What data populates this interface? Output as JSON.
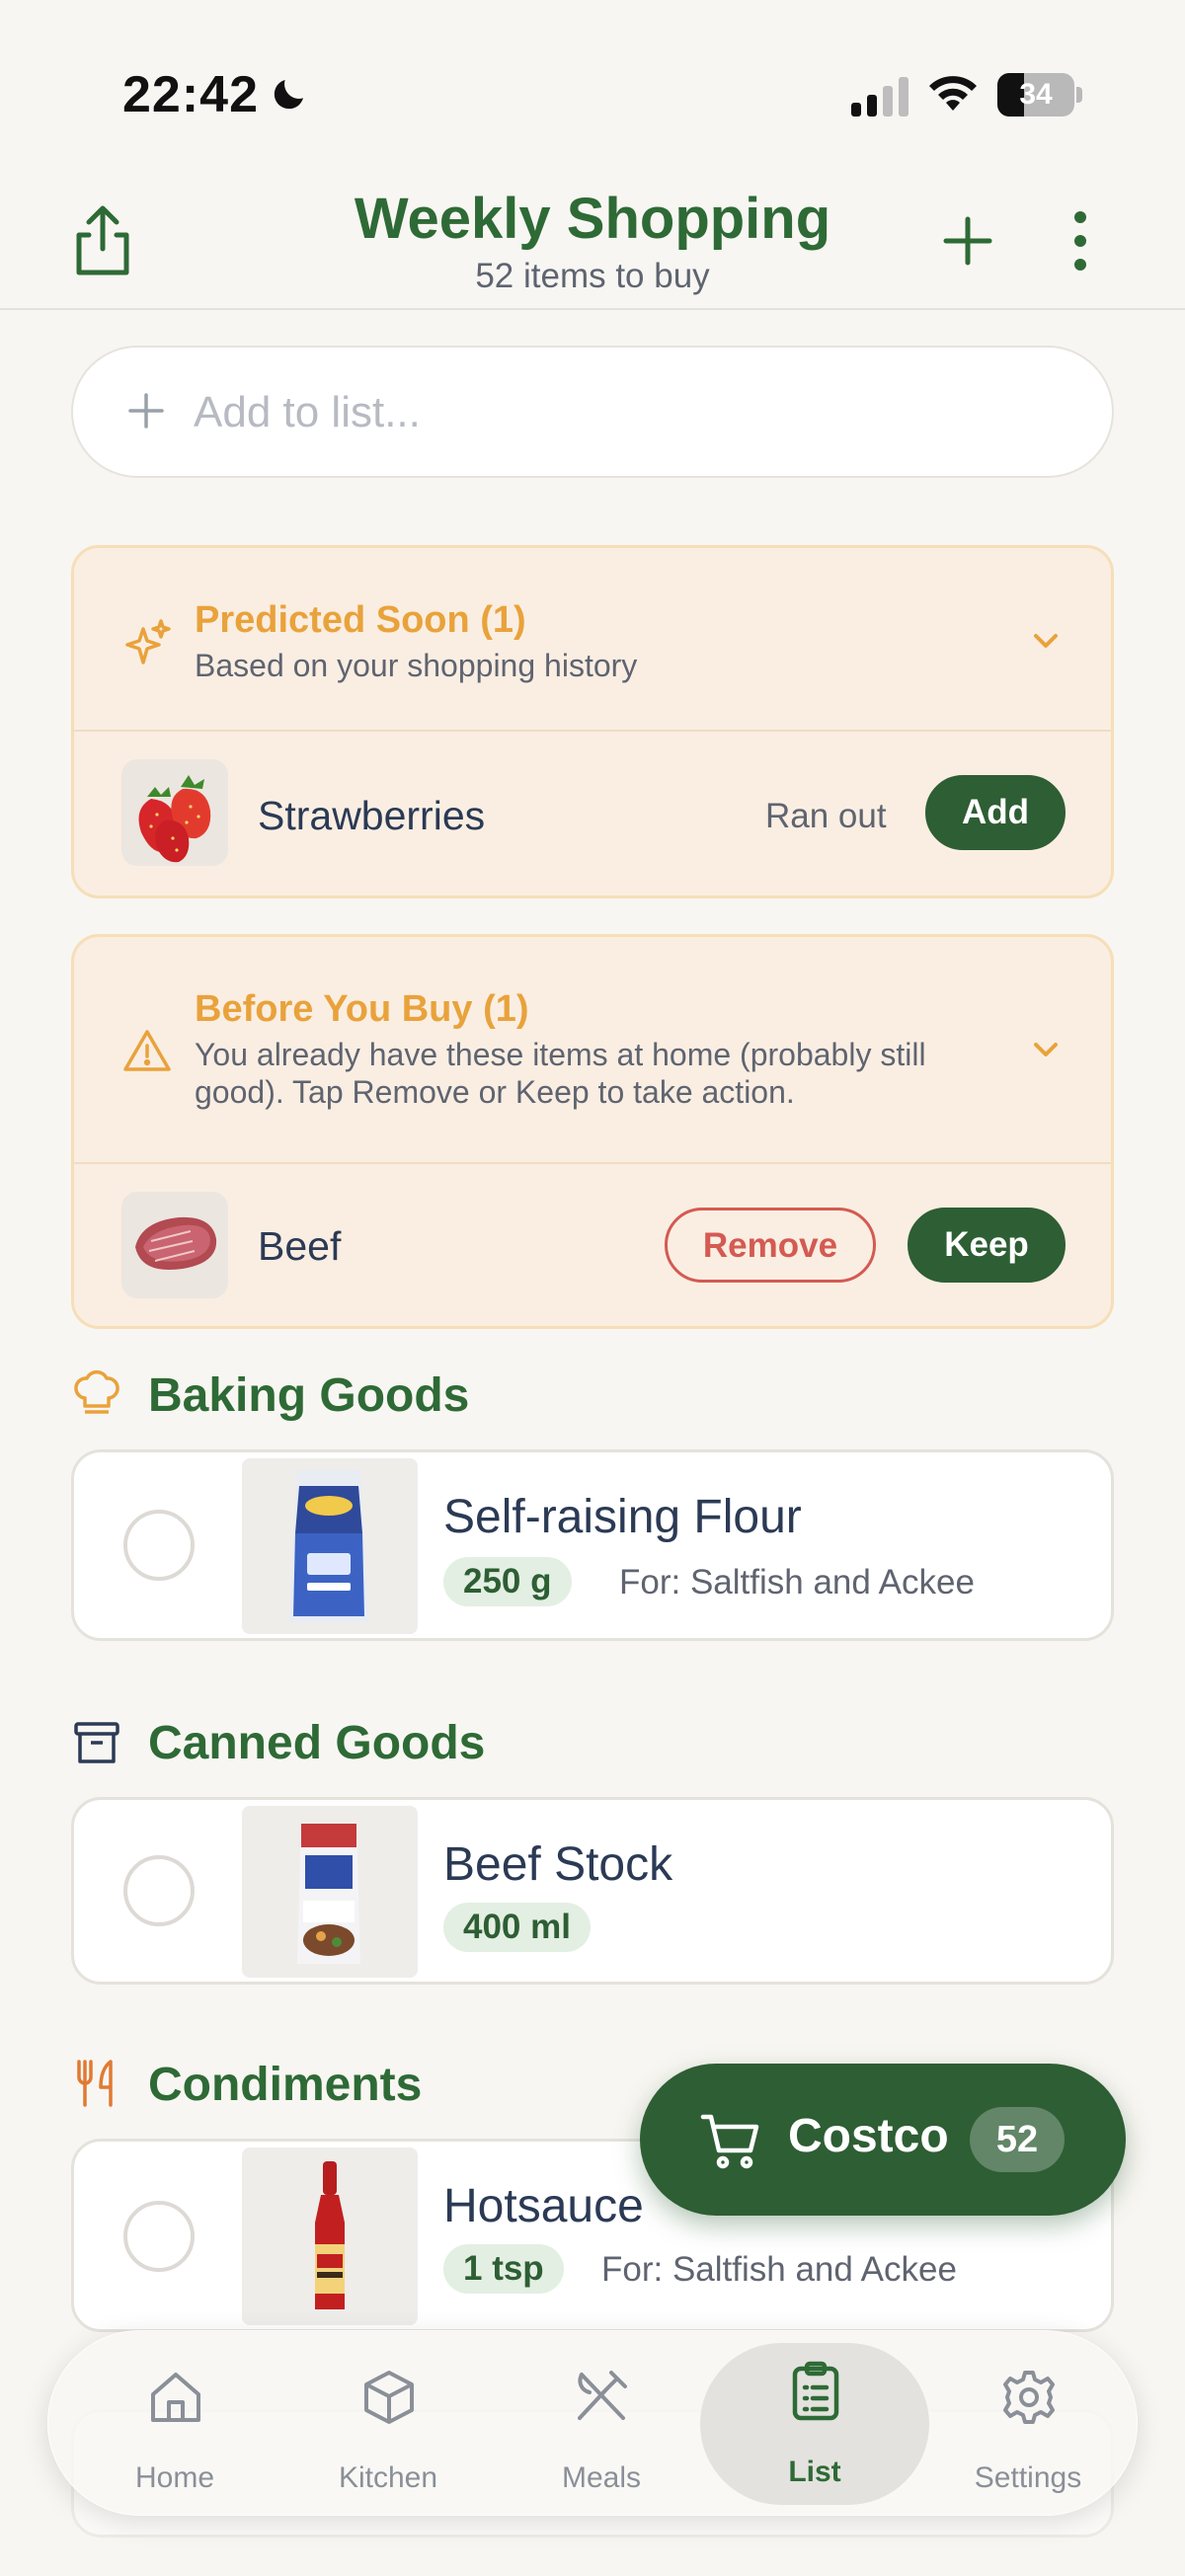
{
  "status_bar": {
    "time": "22:42",
    "battery": "34"
  },
  "header": {
    "title": "Weekly Shopping",
    "subtitle": "52 items to buy"
  },
  "search": {
    "placeholder": "Add to list..."
  },
  "predicted": {
    "title": "Predicted Soon (1)",
    "description": "Based on your shopping history",
    "items": [
      {
        "name": "Strawberries",
        "status": "Ran out",
        "action": "Add"
      }
    ]
  },
  "before_buy": {
    "title": "Before You Buy (1)",
    "description": "You already have these items at home (probably still good). Tap Remove or Keep to take action.",
    "items": [
      {
        "name": "Beef",
        "remove_label": "Remove",
        "keep_label": "Keep"
      }
    ]
  },
  "categories": [
    {
      "title": "Baking Goods",
      "items": [
        {
          "name": "Self-raising Flour",
          "qty": "250 g",
          "for": "For: Saltfish and Ackee"
        }
      ]
    },
    {
      "title": "Canned Goods",
      "items": [
        {
          "name": "Beef Stock",
          "qty": "400 ml"
        }
      ]
    },
    {
      "title": "Condiments",
      "items": [
        {
          "name": "Hotsauce",
          "qty": "1 tsp",
          "for": "For: Saltfish and Ackee"
        }
      ]
    }
  ],
  "store_fab": {
    "label": "Costco",
    "count": "52"
  },
  "tabs": [
    {
      "label": "Home",
      "icon": "home-icon"
    },
    {
      "label": "Kitchen",
      "icon": "box-icon"
    },
    {
      "label": "Meals",
      "icon": "utensils-icon"
    },
    {
      "label": "List",
      "icon": "clipboard-list-icon",
      "active": true
    },
    {
      "label": "Settings",
      "icon": "gear-icon"
    }
  ],
  "colors": {
    "brand_green": "#2e6a36",
    "button_green": "#2e5e34",
    "accent_orange": "#e9a23b",
    "danger_red": "#d45a52",
    "background": "#f8f6f2"
  }
}
